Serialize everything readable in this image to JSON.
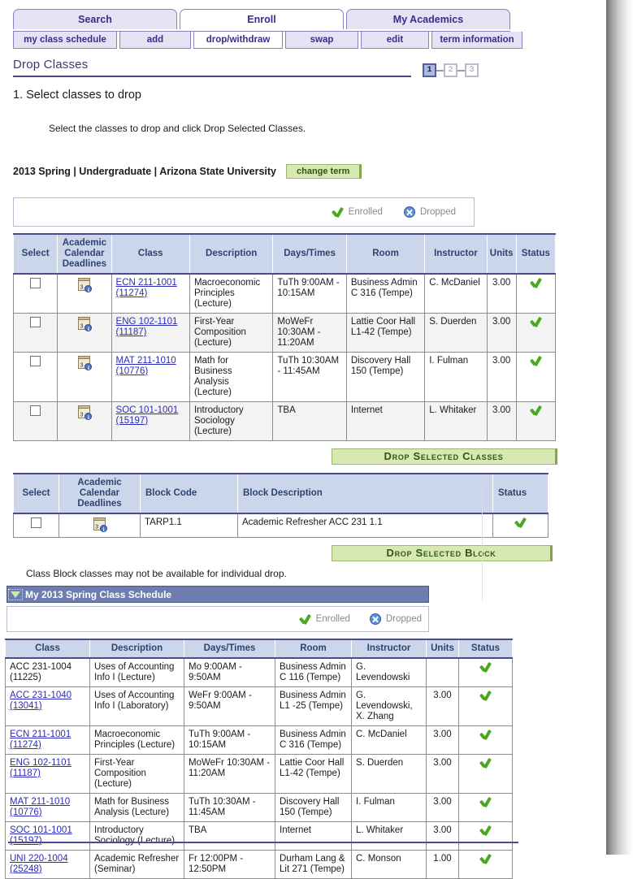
{
  "tabs": [
    {
      "label": "Search",
      "active": false
    },
    {
      "label": "Enroll",
      "active": true
    },
    {
      "label": "My Academics",
      "active": false
    }
  ],
  "subtabs": [
    {
      "label": "my class schedule",
      "active": false
    },
    {
      "label": "add",
      "active": false
    },
    {
      "label": "drop/withdraw",
      "active": true
    },
    {
      "label": "swap",
      "active": false
    },
    {
      "label": "edit",
      "active": false
    },
    {
      "label": "term information",
      "active": false
    }
  ],
  "page": {
    "title": "Drop Classes",
    "step_heading": "1. Select classes to drop",
    "instructions": "Select the classes to drop and click Drop Selected Classes.",
    "term_line": "2013 Spring | Undergraduate | Arizona State University",
    "change_term_label": "change term",
    "note": "Class Block classes may not be available for individual drop."
  },
  "steps": [
    {
      "label": "1",
      "active": true
    },
    {
      "label": "2",
      "active": false
    },
    {
      "label": "3",
      "active": false
    }
  ],
  "legend": {
    "enrolled": "Enrolled",
    "dropped": "Dropped"
  },
  "classes_table": {
    "headers": [
      "Select",
      "Academic Calendar Deadlines",
      "Class",
      "Description",
      "Days/Times",
      "Room",
      "Instructor",
      "Units",
      "Status"
    ],
    "rows": [
      {
        "class": "ECN 211-1001 (11274)",
        "description": "Macroeconomic Principles (Lecture)",
        "days_times": "TuTh 9:00AM - 10:15AM",
        "room": "Business Admin C 316 (Tempe)",
        "instructor": "C. McDaniel",
        "units": "3.00",
        "status": "enrolled"
      },
      {
        "class": "ENG 102-1101 (11187)",
        "description": "First-Year Composition (Lecture)",
        "days_times": "MoWeFr 10:30AM - 11:20AM",
        "room": "Lattie Coor Hall L1-42 (Tempe)",
        "instructor": "S. Duerden",
        "units": "3.00",
        "status": "enrolled"
      },
      {
        "class": "MAT 211-1010 (10776)",
        "description": "Math for Business Analysis (Lecture)",
        "days_times": "TuTh 10:30AM - 11:45AM",
        "room": "Discovery Hall 150 (Tempe)",
        "instructor": "I. Fulman",
        "units": "3.00",
        "status": "enrolled"
      },
      {
        "class": "SOC 101-1001 (15197)",
        "description": "Introductory Sociology (Lecture)",
        "days_times": "TBA",
        "room": "Internet",
        "instructor": "L. Whitaker",
        "units": "3.00",
        "status": "enrolled"
      }
    ]
  },
  "drop_classes_button": "Drop Selected Classes",
  "block_table": {
    "headers": [
      "Select",
      "Academic Calendar Deadlines",
      "Block Code",
      "Block Description",
      "Status"
    ],
    "rows": [
      {
        "block_code": "TARP1.1",
        "block_description": "Academic Refresher ACC 231 1.1",
        "status": "enrolled"
      }
    ]
  },
  "drop_block_button": "Drop Selected Block",
  "schedule": {
    "header": "My 2013 Spring Class Schedule",
    "headers": [
      "Class",
      "Description",
      "Days/Times",
      "Room",
      "Instructor",
      "Units",
      "Status"
    ],
    "rows": [
      {
        "class": "ACC 231-1004 (11225)",
        "is_link": false,
        "description": "Uses of Accounting Info I (Lecture)",
        "days_times": "Mo 9:00AM - 9:50AM",
        "room": "Business Admin C 116 (Tempe)",
        "instructor": "G. Levendowski",
        "units": "",
        "status": "enrolled"
      },
      {
        "class": "ACC 231-1040 (13041)",
        "is_link": true,
        "description": "Uses of Accounting Info I (Laboratory)",
        "days_times": "WeFr 9:00AM - 9:50AM",
        "room": "Business Admin L1 -25 (Tempe)",
        "instructor": "G. Levendowski, X. Zhang",
        "units": "3.00",
        "status": "enrolled"
      },
      {
        "class": "ECN 211-1001 (11274)",
        "is_link": true,
        "description": "Macroeconomic Principles (Lecture)",
        "days_times": "TuTh 9:00AM - 10:15AM",
        "room": "Business Admin C 316 (Tempe)",
        "instructor": "C. McDaniel",
        "units": "3.00",
        "status": "enrolled"
      },
      {
        "class": "ENG 102-1101 (11187)",
        "is_link": true,
        "description": "First-Year Composition (Lecture)",
        "days_times": "MoWeFr 10:30AM - 11:20AM",
        "room": "Lattie Coor Hall L1-42 (Tempe)",
        "instructor": "S. Duerden",
        "units": "3.00",
        "status": "enrolled"
      },
      {
        "class": "MAT 211-1010 (10776)",
        "is_link": true,
        "description": "Math for Business Analysis (Lecture)",
        "days_times": "TuTh 10:30AM - 11:45AM",
        "room": "Discovery Hall 150 (Tempe)",
        "instructor": "I. Fulman",
        "units": "3.00",
        "status": "enrolled"
      },
      {
        "class": "SOC 101-1001 (15197)",
        "is_link": true,
        "description": "Introductory Sociology (Lecture)",
        "days_times": "TBA",
        "room": "Internet",
        "instructor": "L. Whitaker",
        "units": "3.00",
        "status": "enrolled"
      },
      {
        "class": "UNI 220-1004 (25248)",
        "is_link": true,
        "description": "Academic Refresher (Seminar)",
        "days_times": "Fr 12:00PM - 12:50PM",
        "room": "Durham Lang & Lit 271 (Tempe)",
        "instructor": "C. Monson",
        "units": "1.00",
        "status": "enrolled"
      }
    ]
  },
  "colors": {
    "tab_bg": "#e6e2f4",
    "tab_text": "#3a2b8c",
    "table_header_bg": "#ccd6ea",
    "table_header_text": "#2d4372",
    "button_green_bg": "#d8e8b4",
    "button_green_text": "#2e5717",
    "schedule_header_bg": "#6e7cb0",
    "link": "#2b2bbb",
    "enrolled_check": "#4aa81e",
    "dropped_circle": "#5b8fd4"
  }
}
